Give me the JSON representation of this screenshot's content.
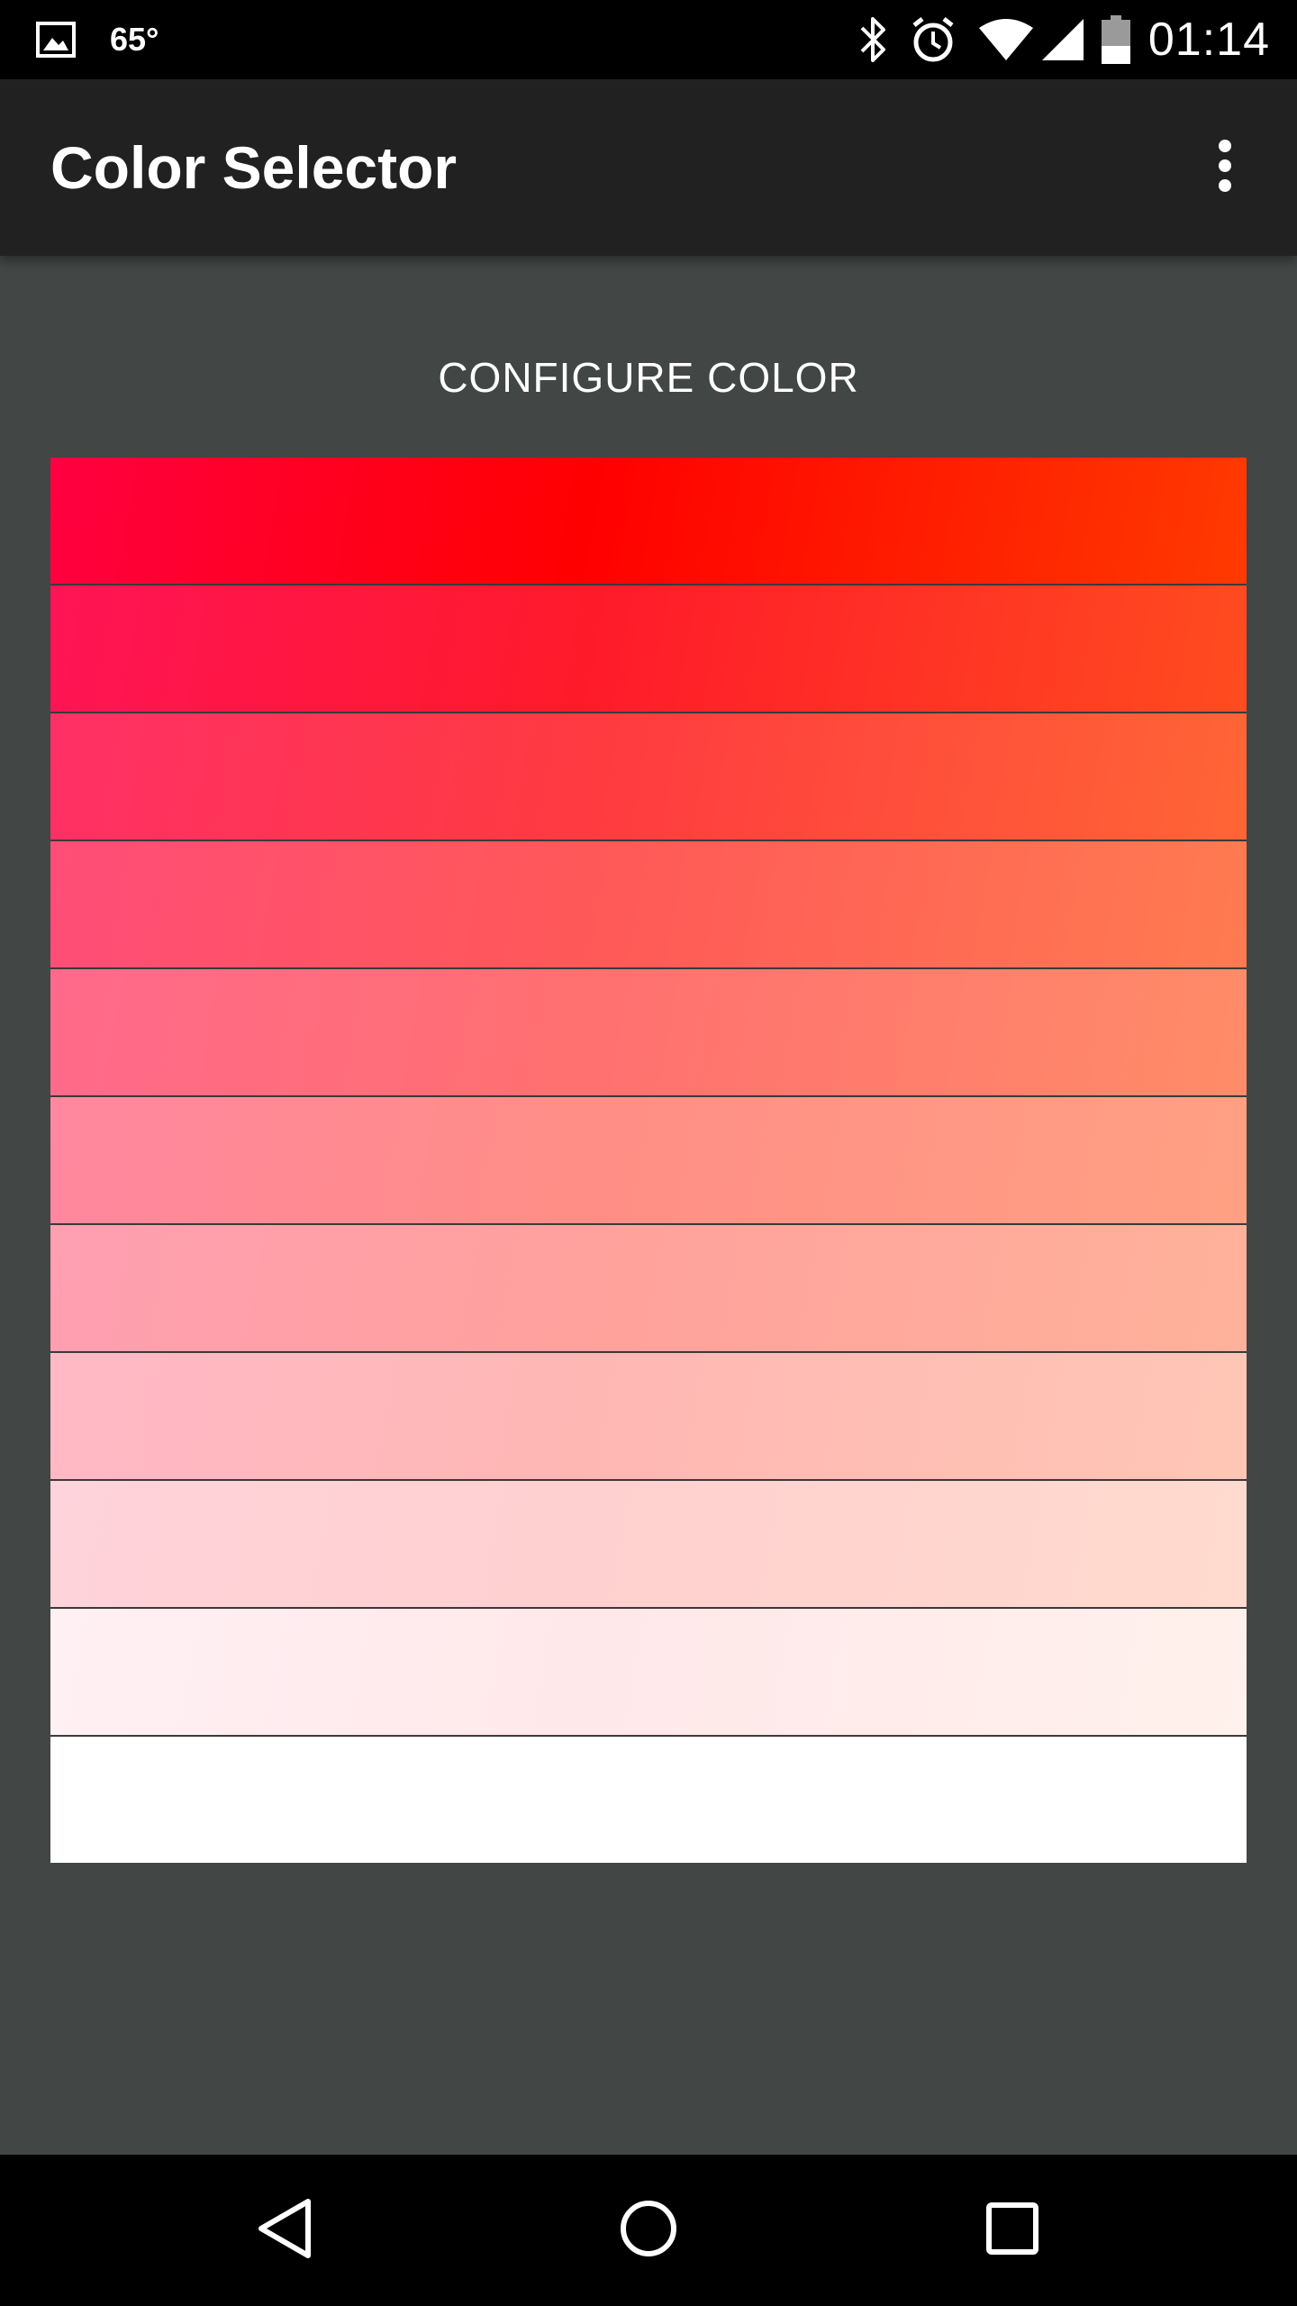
{
  "status_bar": {
    "icons": [
      "image-icon",
      "bluetooth-icon",
      "alarm-icon",
      "wifi-icon",
      "signal-icon",
      "battery-icon"
    ],
    "temperature": "65°",
    "time": "01:14"
  },
  "app_bar": {
    "title": "Color Selector",
    "menu_icon": "overflow-menu-icon"
  },
  "content": {
    "heading": "CONFIGURE COLOR",
    "swatches": [
      {
        "from": "#FF0041",
        "mid": "#FF0000",
        "to": "#FF3A00"
      },
      {
        "from": "#FF1456",
        "mid": "#FF1A2A",
        "to": "#FF4C1F"
      },
      {
        "from": "#FF3066",
        "mid": "#FF3A40",
        "to": "#FF6535"
      },
      {
        "from": "#FF4D78",
        "mid": "#FF5858",
        "to": "#FF7B50"
      },
      {
        "from": "#FF6A8B",
        "mid": "#FF7070",
        "to": "#FF8C68"
      },
      {
        "from": "#FF879F",
        "mid": "#FF8E86",
        "to": "#FFA083"
      },
      {
        "from": "#FF9FB2",
        "mid": "#FFA19C",
        "to": "#FFB29B"
      },
      {
        "from": "#FFB9C6",
        "mid": "#FFB7B4",
        "to": "#FFC6B5"
      },
      {
        "from": "#FFD3DB",
        "mid": "#FFD0CF",
        "to": "#FFDACE"
      },
      {
        "from": "#FFF0F4",
        "mid": "#FFE8EA",
        "to": "#FFF1EC"
      },
      {
        "from": "#FFFFFF",
        "mid": "#FFFFFF",
        "to": "#FFFFFF"
      }
    ]
  },
  "nav_bar": {
    "back_icon": "back-triangle-icon",
    "home_icon": "home-circle-icon",
    "recents_icon": "recents-square-icon"
  }
}
